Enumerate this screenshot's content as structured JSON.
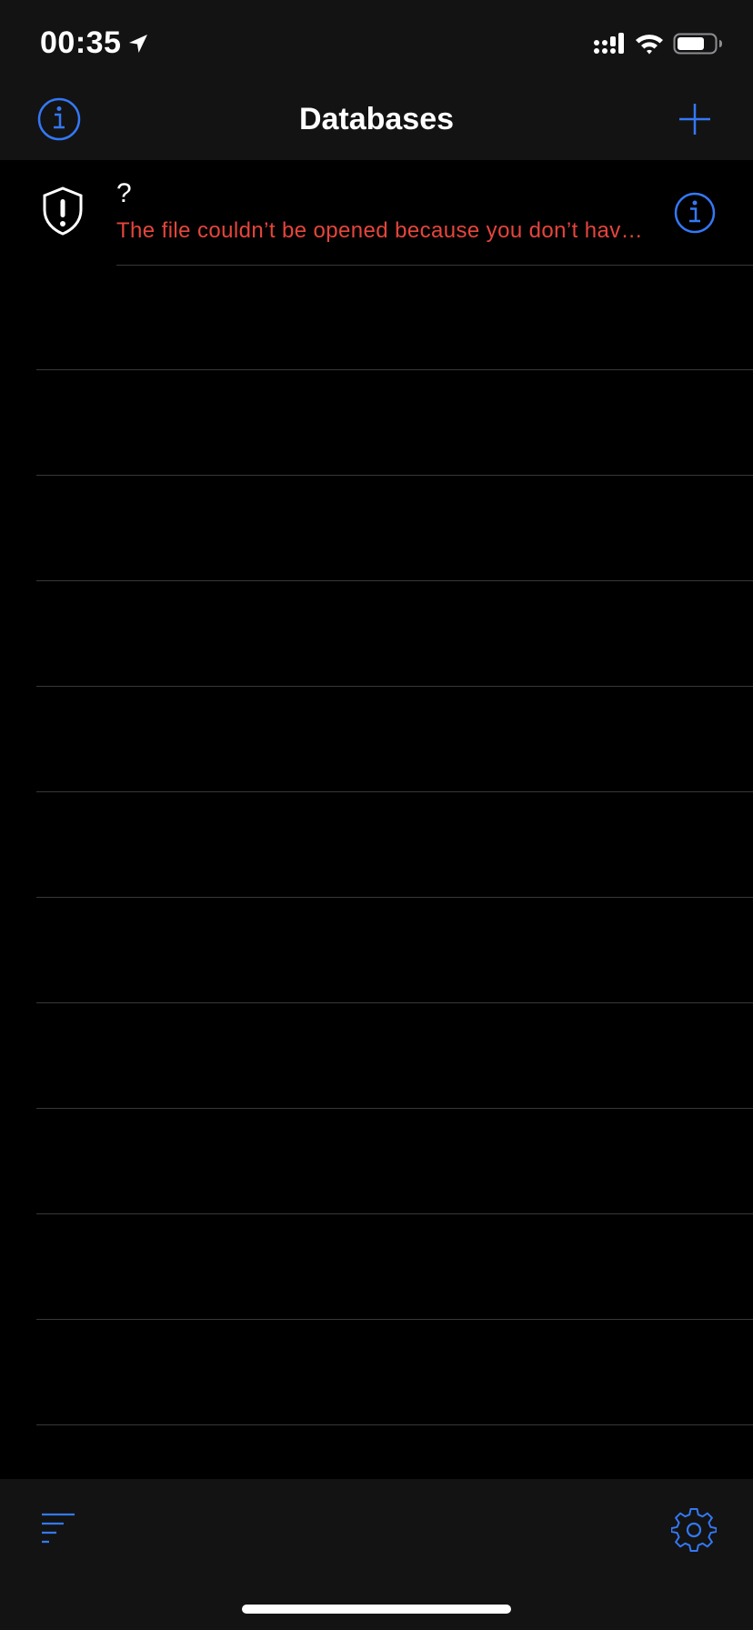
{
  "status_bar": {
    "time": "00:35",
    "icons": [
      "location-arrow-icon",
      "cellular-signal-icon",
      "wifi-icon",
      "battery-icon"
    ]
  },
  "nav": {
    "title": "Databases",
    "left_icon": "info-icon",
    "right_icon": "plus-icon"
  },
  "databases": [
    {
      "icon": "shield-exclamation-icon",
      "name": "?",
      "error": "The file couldn’t be opened because you don’t hav…",
      "accessory_icon": "info-icon"
    }
  ],
  "toolbar": {
    "left_icon": "sort-icon",
    "right_icon": "gear-icon"
  },
  "colors": {
    "accent": "#3478f6",
    "error": "#e5453c",
    "bar_background": "#131313",
    "list_background": "#000000",
    "separator": "#38383a"
  }
}
